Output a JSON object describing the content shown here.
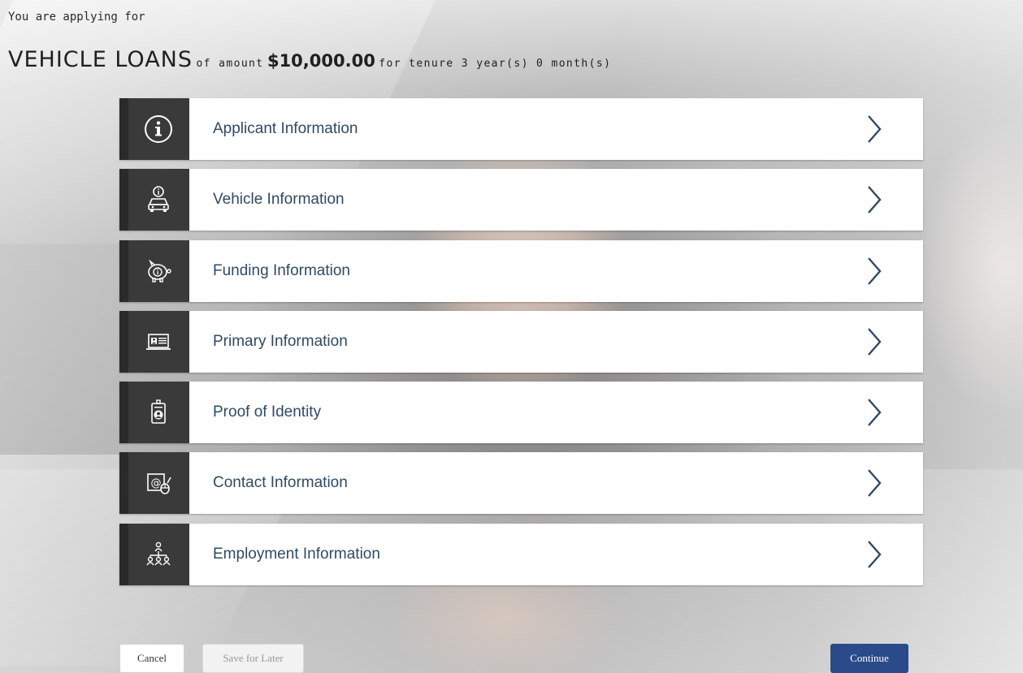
{
  "header": {
    "applying_text": "You are applying for",
    "product": "VEHICLE LOANS",
    "of_amount_text": "of amount",
    "amount": "$10,000.00",
    "tenure_text": "for tenure 3 year(s) 0 month(s)"
  },
  "sections": [
    {
      "label": "Applicant Information",
      "icon": "info-icon"
    },
    {
      "label": "Vehicle Information",
      "icon": "vehicle-info-icon"
    },
    {
      "label": "Funding Information",
      "icon": "piggy-bank-icon"
    },
    {
      "label": "Primary Information",
      "icon": "id-card-laptop-icon"
    },
    {
      "label": "Proof of Identity",
      "icon": "id-badge-icon"
    },
    {
      "label": "Contact Information",
      "icon": "contact-email-icon"
    },
    {
      "label": "Employment Information",
      "icon": "org-chart-icon"
    }
  ],
  "buttons": {
    "cancel": "Cancel",
    "save_for_later": "Save for Later",
    "continue": "Continue"
  },
  "colors": {
    "icon_panel": "#3a3a3a",
    "label_text": "#2f4a63",
    "continue_button": "#2a4a8a"
  }
}
